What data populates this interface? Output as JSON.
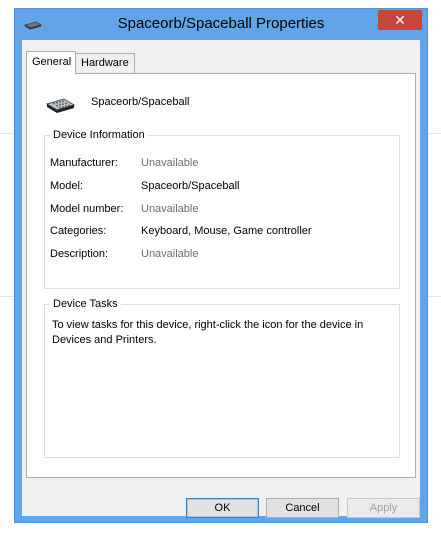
{
  "window": {
    "title": "Spaceorb/Spaceball Properties",
    "close_glyph": "✕",
    "icon": "device-icon"
  },
  "tabs": [
    {
      "label": "General",
      "active": true
    },
    {
      "label": "Hardware",
      "active": false
    }
  ],
  "device": {
    "name": "Spaceorb/Spaceball",
    "icon": "spaceball-device-icon"
  },
  "device_information": {
    "legend": "Device Information",
    "rows": [
      {
        "label": "Manufacturer:",
        "value": "Unavailable"
      },
      {
        "label": "Model:",
        "value": "Spaceorb/Spaceball"
      },
      {
        "label": "Model number:",
        "value": "Unavailable"
      },
      {
        "label": "Categories:",
        "value": "Keyboard, Mouse, Game controller"
      },
      {
        "label": "Description:",
        "value": "Unavailable"
      }
    ]
  },
  "device_tasks": {
    "legend": "Device Tasks",
    "text": "To view tasks for this device, right-click the icon for the device in Devices and Printers."
  },
  "buttons": {
    "ok": "OK",
    "cancel": "Cancel",
    "apply": "Apply"
  },
  "colors": {
    "frame": "#61a5e8",
    "close_button": "#c7463c",
    "dialog_bg": "#f0f0f0"
  }
}
